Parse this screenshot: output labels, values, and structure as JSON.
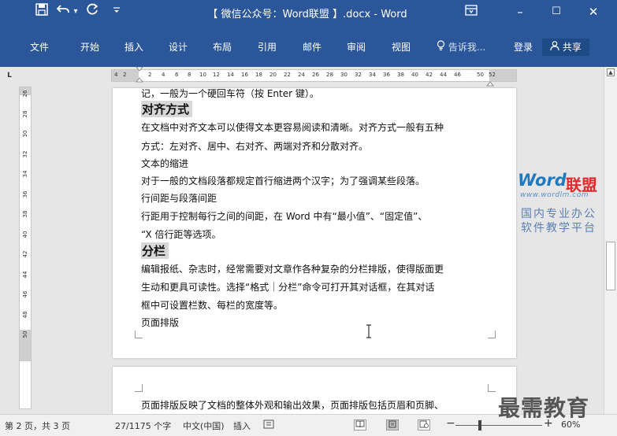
{
  "quick_access": {
    "save_icon": "save-icon",
    "undo_icon": "undo-icon",
    "undo_dropdown": "▾",
    "redo_icon": "redo-icon",
    "customize_icon": "customize-icon"
  },
  "window": {
    "title": "【 微信公众号：Word联盟 】.docx - Word",
    "ribbon_display_icon": "ribbon-display-icon",
    "minimize": "–",
    "maximize": "☐",
    "close": "✕"
  },
  "ribbon": {
    "tabs": [
      "文件",
      "开始",
      "插入",
      "设计",
      "布局",
      "引用",
      "邮件",
      "审阅",
      "视图"
    ],
    "tellme": "告诉我...",
    "signin": "登录",
    "share": "共享"
  },
  "ruler": {
    "corner": "L",
    "h_ticks": [
      "4",
      "2",
      "2",
      "4",
      "6",
      "8",
      "10",
      "12",
      "14",
      "16",
      "18",
      "20",
      "22",
      "24",
      "26",
      "28",
      "30",
      "32",
      "34",
      "36",
      "38",
      "40",
      "42",
      "44",
      "46",
      "50",
      "52"
    ],
    "v_ticks": [
      "26",
      "28",
      "30",
      "32",
      "34",
      "36",
      "38",
      "40",
      "42",
      "44",
      "46",
      "48",
      "50"
    ]
  },
  "page1": {
    "line_cut": "记，一般为一个硬回车符（按 Enter 键）。",
    "heading1": "对齐方式",
    "p1a": "在文档中对齐文本可以使得文本更容易阅读和清晰。对齐方式一般有五种",
    "p1b": "方式：左对齐、居中、右对齐、两端对齐和分散对齐。",
    "p2": "文本的缩进",
    "p3": "对于一般的文档段落都规定首行缩进两个汉字；为了强调某些段落。",
    "p4": "行间距与段落间距",
    "p5a": "行距用于控制每行之间的间距，在 Word 中有“最小值”、“固定值”、",
    "p5b": "“X 倍行距等选项。",
    "heading2": "分栏",
    "p6a": "编辑报纸、杂志时，经常需要对文章作各种复杂的分栏排版，使得版面更",
    "p6b": "生动和更具可读性。选择“格式｜分栏”命令可打开其对话框，在其对话",
    "p6c": "框中可设置栏数、每栏的宽度等。",
    "p7": "页面排版"
  },
  "page2": {
    "p1": "页面排版反映了文档的整体外观和输出效果，页面排版包括页眉和页脚、"
  },
  "watermark": {
    "word": "Word",
    "lianmeng": "联盟",
    "url": "www.wordlm.com",
    "slogan1": "国内专业办公",
    "slogan2": "软件教学平台",
    "corner_brand": "最需教育"
  },
  "status": {
    "page": "第 2 页，共 3 页",
    "words": "27/1175 个字",
    "language": "中文(中国)",
    "mode": "插入",
    "zoom_level": 0.6,
    "zoom_label": "60%"
  }
}
